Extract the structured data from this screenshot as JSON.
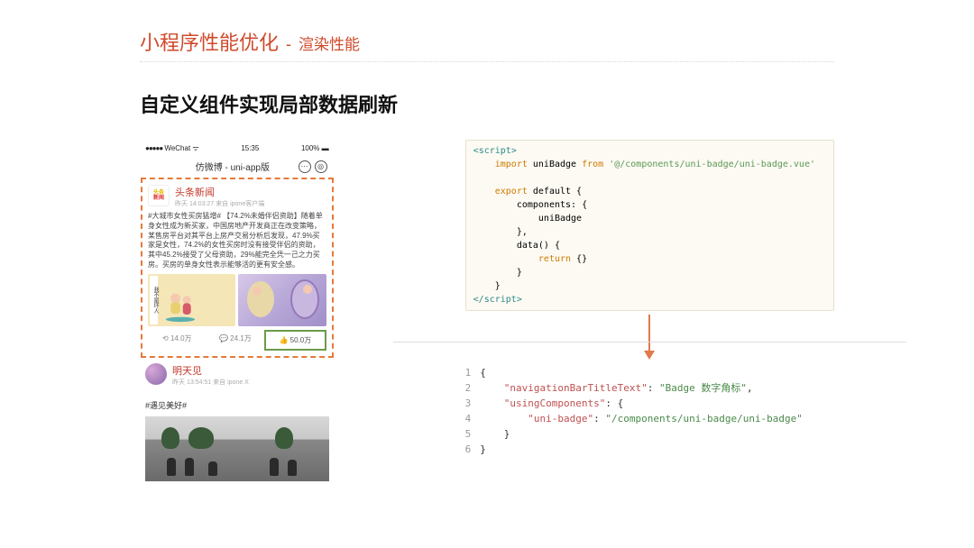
{
  "header": {
    "title_main": "小程序性能优化",
    "title_dash": "-",
    "title_sub": "渲染性能"
  },
  "subtitle": "自定义组件实现局部数据刷新",
  "phone": {
    "statusbar": {
      "carrier": "WeChat",
      "signal_dots": "●●●●●",
      "wifi": "ᯤ",
      "time": "15:35",
      "battery": "100%"
    },
    "appbar": {
      "title": "仿微博 - uni-app版",
      "more": "⋯",
      "target": "◎"
    },
    "post1": {
      "logo_top": "头条",
      "logo_bot": "新闻",
      "name": "头条新闻",
      "meta": "昨天 14:03:27 来自 ipone客户端",
      "body": "#大城市女性买房猛增# 【74.2%未婚伴侣资助】随着单身女性成为新买家，中国房地产开发商正在改变策略，某售房平台对其平台上房产交易分析后发现，47.9%买家是女性，74.2%的女性买房时没有接受伴侣的资助，其中45.2%接受了父母资助，29%能完全凭一己之力买房。买房的单身女性表示能够活的更有安全感。",
      "thumb_vtext": "我不是坏人",
      "actions": {
        "repost": "⟲ 14.0万",
        "comment": "💬 24.1万",
        "like": "👍 50.0万"
      }
    },
    "post2": {
      "name": "明天见",
      "meta": "昨天 13:54:51 来自 ipone X",
      "hashtag": "#遇见美好#"
    }
  },
  "code1": {
    "l1a": "<",
    "l1b": "script",
    "l1c": ">",
    "l2a": "import",
    "l2b": " uniBadge ",
    "l2c": "from",
    "l2d": " '@/components/uni-badge/uni-badge.vue'",
    "l3a": "export",
    "l3b": " default {",
    "l4": "components: {",
    "l5": "uniBadge",
    "l6": "},",
    "l7": "data() {",
    "l8a": "return",
    "l8b": " {}",
    "l9": "}",
    "l10": "}",
    "l11a": "</",
    "l11b": "script",
    "l11c": ">"
  },
  "code2": {
    "linenos": "1\n2\n3\n4\n5\n6",
    "l1": "{",
    "l2k": "\"navigationBarTitleText\"",
    "l2c": ": ",
    "l2v": "\"Badge 数字角标\"",
    "l2e": ",",
    "l3k": "\"usingComponents\"",
    "l3c": ": {",
    "l4k": "\"uni-badge\"",
    "l4c": ": ",
    "l4v": "\"/components/uni-badge/uni-badge\"",
    "l5": "}",
    "l6": "}"
  }
}
